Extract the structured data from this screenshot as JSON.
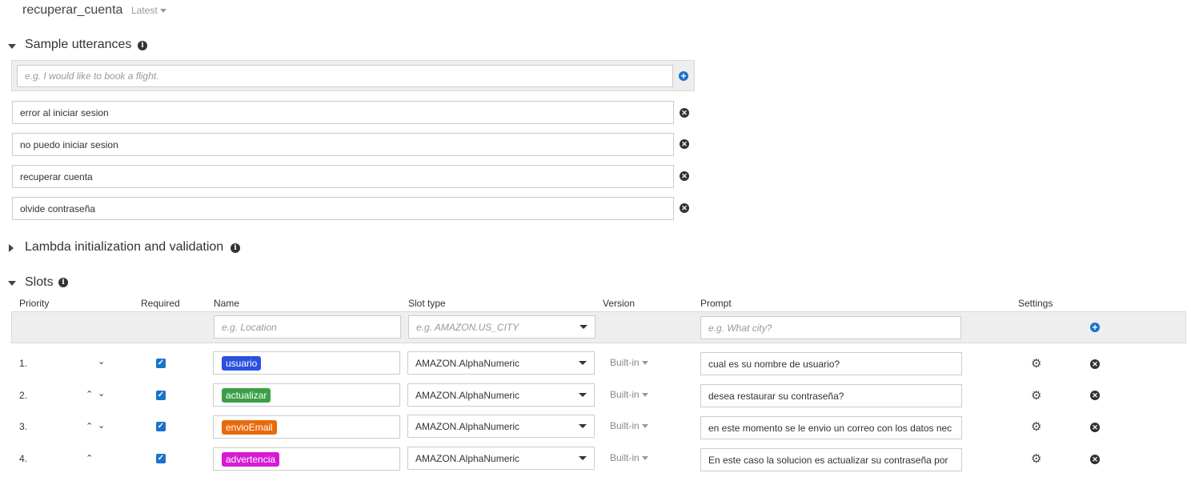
{
  "intent": {
    "name": "recuperar_cuenta",
    "version": "Latest"
  },
  "sample_utterances": {
    "heading": "Sample utterances",
    "placeholder": "e.g. I would like to book a flight.",
    "items": [
      "error al iniciar sesion",
      "no puedo iniciar sesion",
      "recuperar cuenta",
      "olvide contraseña"
    ]
  },
  "lambda": {
    "heading": "Lambda initialization and validation"
  },
  "slots": {
    "heading": "Slots",
    "columns": {
      "priority": "Priority",
      "required": "Required",
      "name": "Name",
      "slot_type": "Slot type",
      "version": "Version",
      "prompt": "Prompt",
      "settings": "Settings"
    },
    "new_slot": {
      "name_placeholder": "e.g. Location",
      "type_placeholder": "e.g. AMAZON.US_CITY",
      "prompt_placeholder": "e.g. What city?"
    },
    "rows": [
      {
        "priority": "1.",
        "name": "usuario",
        "name_color": "#2b50e0",
        "type": "AMAZON.AlphaNumeric",
        "version": "Built-in",
        "prompt": "cual es su nombre de usuario?"
      },
      {
        "priority": "2.",
        "name": "actualizar",
        "name_color": "#3aa046",
        "type": "AMAZON.AlphaNumeric",
        "version": "Built-in",
        "prompt": "desea restaurar su contraseña?"
      },
      {
        "priority": "3.",
        "name": "envioEmail",
        "name_color": "#e86a0c",
        "type": "AMAZON.AlphaNumeric",
        "version": "Built-in",
        "prompt": "en este momento se le envio un correo con los datos nec"
      },
      {
        "priority": "4.",
        "name": "advertencia",
        "name_color": "#d61ad6",
        "type": "AMAZON.AlphaNumeric",
        "version": "Built-in",
        "prompt": "En este caso la solucion es actualizar su contraseña por"
      }
    ]
  }
}
